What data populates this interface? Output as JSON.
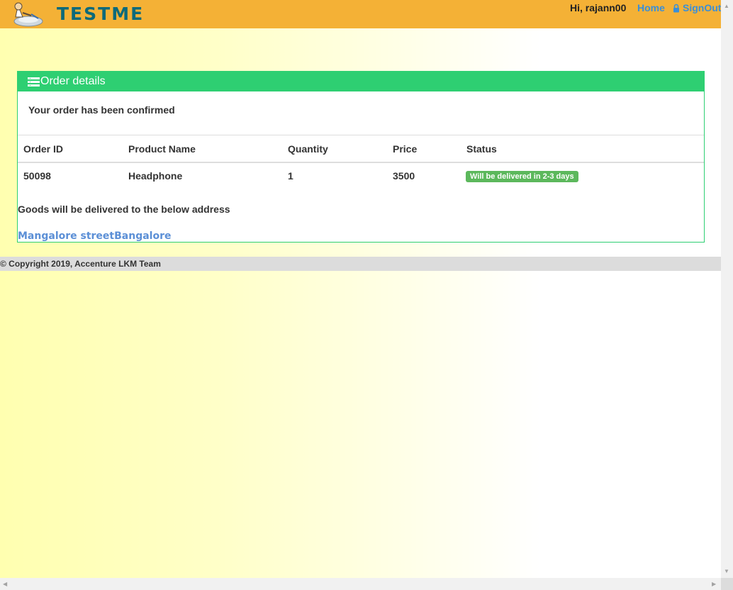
{
  "header": {
    "brand": "TESTME",
    "greeting": "Hi, rajann00",
    "home_label": "Home",
    "signout_label": "SignOut",
    "lock_icon": "lock-icon",
    "background": "#f4b136"
  },
  "panel": {
    "heading": "Order details",
    "heading_icon": "list-icon",
    "accent": "#2ecf72",
    "confirmation": "Your order has been confirmed",
    "table": {
      "columns": [
        "Order ID",
        "Product Name",
        "Quantity",
        "Price",
        "Status"
      ],
      "rows": [
        {
          "order_id": "50098",
          "product": "Headphone",
          "quantity": "1",
          "price": "3500",
          "status": "Will be delivered in 2-3 days"
        }
      ]
    },
    "delivery_note": "Goods will be delivered to the below address",
    "address": "Mangalore streetBangalore"
  },
  "footer": {
    "copyright": "© Copyright 2019, Accenture LKM Team"
  },
  "scrollbars": {
    "up_arrow": "▲",
    "down_arrow": "▼",
    "left_arrow": "◀",
    "right_arrow": "▶"
  }
}
